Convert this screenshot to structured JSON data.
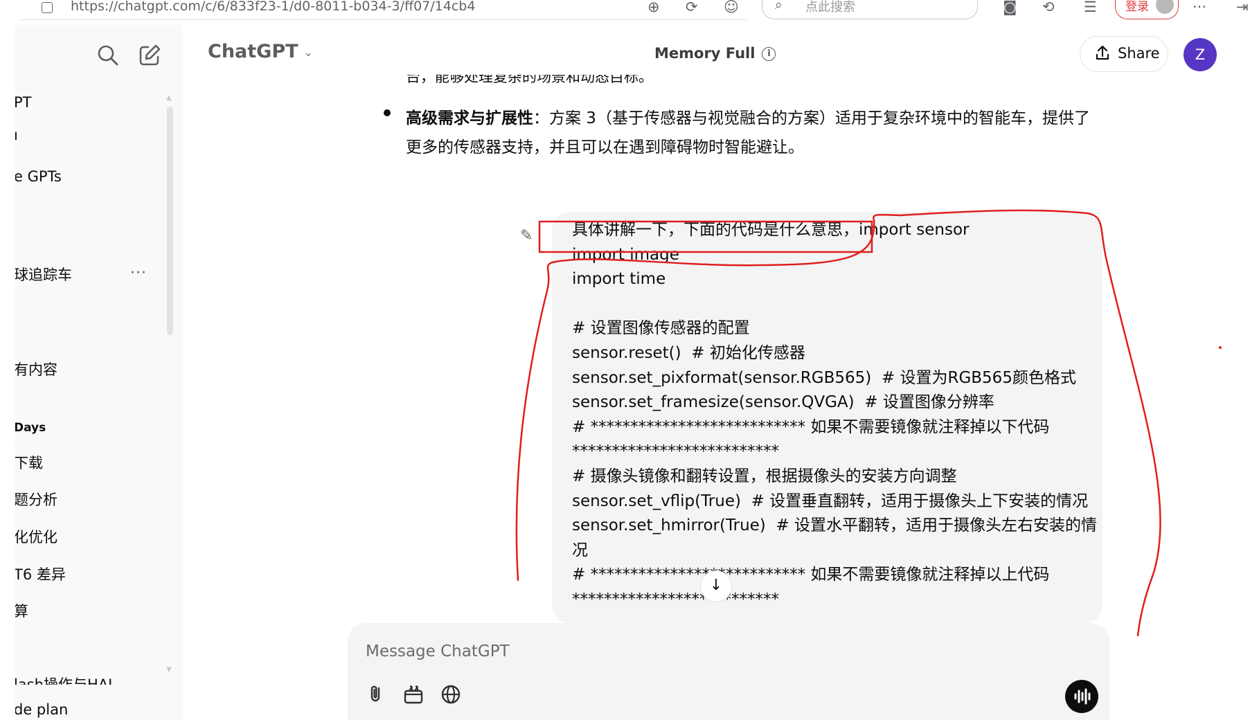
{
  "browser": {
    "url": "https://chatgpt.com/c/6/833f23-1/d0-8011-b034-3/ff07/14cb4",
    "search_placeholder": "点此搜索",
    "login_label": "登录"
  },
  "sidebar": {
    "items": [
      {
        "label": "PT"
      },
      {
        "label": "ı"
      },
      {
        "label": "e GPTs"
      },
      {
        "label": "球追踪车"
      },
      {
        "label": "有内容"
      },
      {
        "label": "下载"
      },
      {
        "label": "题分析"
      },
      {
        "label": "化优化"
      },
      {
        "label": "T6 差异"
      },
      {
        "label": "算"
      },
      {
        "label": "lash操作与HAL"
      },
      {
        "label": "de plan"
      }
    ],
    "section_label": "Days",
    "more_label": "···"
  },
  "header": {
    "brand": "ChatGPT",
    "memory_label": "Memory Full",
    "share_label": "Share",
    "avatar_letter": "Z"
  },
  "assistant": {
    "clipped_line": "台，能够处理复杂的场景和动态目标。",
    "bullet_bold": "高级需求与扩展性",
    "bullet_text": "：方案 3（基于传感器与视觉融合的方案）适用于复杂环境中的智能车，提供了更多的传感器支持，并且可以在遇到障碍物时智能避让。"
  },
  "user_message": {
    "text": "具体讲解一下，下面的代码是什么意思，import sensor\nimport image\nimport time\n\n# 设置图像传感器的配置\nsensor.reset()  # 初始化传感器\nsensor.set_pixformat(sensor.RGB565)  # 设置为RGB565颜色格式\nsensor.set_framesize(sensor.QVGA)  # 设置图像分辨率\n# *************************** 如果不需要镜像就注释掉以下代码 **************************\n# 摄像头镜像和翻转设置，根据摄像头的安装方向调整\nsensor.set_vflip(True)  # 设置垂直翻转，适用于摄像头上下安装的情况\nsensor.set_hmirror(True)  # 设置水平翻转，适用于摄像头左右安装的情况\n# *************************** 如果不需要镜像就注释掉以上代码 **************************"
  },
  "composer": {
    "placeholder": "Message ChatGPT"
  },
  "colors": {
    "accent_avatar": "#5637c4",
    "annotation_red": "#e01e1e",
    "sidebar_bg": "#f9f9f9",
    "bubble_bg": "#f4f4f4"
  }
}
